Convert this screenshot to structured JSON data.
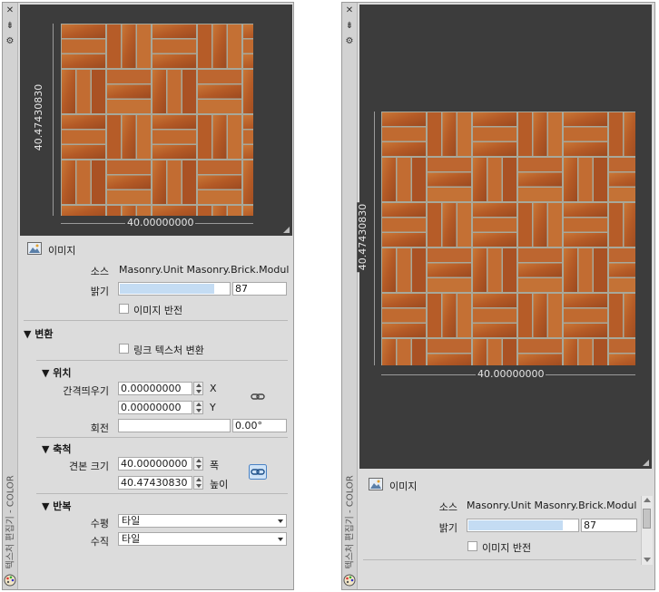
{
  "left": {
    "panel_title": "텍스처 편집기 - COLOR",
    "width_dim": "40.00000000",
    "height_dim": "40.47430830",
    "image_section": "이미지",
    "source_label": "소스",
    "source_value": "Masonry.Unit Masonry.Brick.Modular.",
    "brightness_label": "밝기",
    "brightness_value": "87",
    "brightness_fraction": 0.87,
    "invert_label": "이미지 반전",
    "transform_section": "변환",
    "link_transform_label": "링크 텍스처 변환",
    "position_section": "위치",
    "offset_label": "간격띄우기",
    "offset_x": "0.00000000",
    "offset_x_axis": "X",
    "offset_y": "0.00000000",
    "offset_y_axis": "Y",
    "rotation_label": "회전",
    "rotation_value": "0.00°",
    "scale_section": "축척",
    "sample_size_label": "견본 크기",
    "scale_width": "40.00000000",
    "scale_width_label": "폭",
    "scale_height": "40.47430830",
    "scale_height_label": "높이",
    "repeat_section": "반복",
    "horizontal_label": "수평",
    "horizontal_value": "타일",
    "vertical_label": "수직",
    "vertical_value": "타일"
  },
  "right": {
    "panel_title": "텍스처 편집기 - COLOR",
    "width_dim": "40.00000000",
    "height_dim": "40.47430830",
    "image_section": "이미지",
    "source_label": "소스",
    "source_value": "Masonry.Unit Masonry.Brick.Modul",
    "brightness_label": "밝기",
    "brightness_value": "87",
    "brightness_fraction": 0.87,
    "invert_label": "이미지 반전"
  },
  "colors": {
    "panel_bg": "#dcdcdc",
    "preview_bg": "#3c3c3c",
    "brick": "#b8602a",
    "mortar": "#a8a89a",
    "brightness_fill": "#c4dcf3"
  },
  "icons": [
    "close-icon",
    "pin-icon",
    "settings-icon",
    "link-icon",
    "image-icon",
    "palette-icon",
    "resize-grip-icon"
  ]
}
